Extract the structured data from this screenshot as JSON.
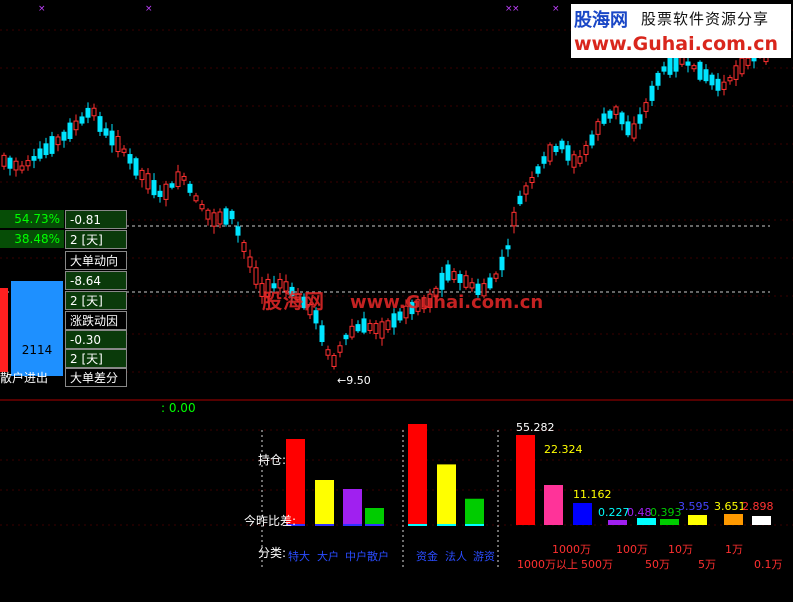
{
  "watermark": {
    "logo_cn": "股海网",
    "logo_tag": "股票软件资源分享",
    "logo_url": "www.Guhai.com.cn",
    "mid_cn": "股海网",
    "mid_url": "www.Guhai.com.cn"
  },
  "price_chart": {
    "low_marker": "←9.50",
    "low_price": 9.5,
    "price_range": [
      9.2,
      12.7
    ]
  },
  "side_panel": {
    "pct1": "54.73%",
    "pct2": "38.48%",
    "rows": [
      {
        "value": "-0.81",
        "days": "2 [天]",
        "label": "大单动向"
      },
      {
        "value": "-8.64",
        "days": "2 [天]",
        "label": "涨跌动因"
      },
      {
        "value": "-0.30",
        "days": "2 [天]",
        "label": "大单差分"
      }
    ],
    "box_value": "2114",
    "bottom_label": "散户进出",
    "colors": {
      "green": "#00ff00",
      "blue": "#1e90ff",
      "red": "#ff2020"
    }
  },
  "indicator": {
    "zero_label": ": 0.00",
    "label_hold": "持仓:",
    "label_diff": "今昨比差:",
    "label_class": "分类:"
  },
  "chart_data": {
    "type": "bar",
    "groups": [
      {
        "categories": [
          "特大",
          "大户",
          "中户",
          "散户"
        ],
        "values": [
          0.86,
          0.45,
          0.36,
          0.17
        ],
        "colors": [
          "#ff0000",
          "#ffff00",
          "#a020f0",
          "#00cc00"
        ]
      },
      {
        "categories": [
          "资金",
          "法人",
          "游资"
        ],
        "values": [
          1.0,
          0.6,
          0.26
        ],
        "colors": [
          "#ff0000",
          "#ffff00",
          "#00cc00"
        ]
      },
      {
        "categories": [
          "1000万以上",
          "500万",
          "1000万",
          "100万",
          "50万",
          "10万",
          "5万",
          "1万",
          "0.1万"
        ],
        "values": [
          55.282,
          22.324,
          11.162,
          0.227,
          0.48,
          0.393,
          3.595,
          3.651,
          2.898
        ],
        "value_labels": [
          "55.282",
          "22.324",
          "11.162",
          "0.227",
          "0.48",
          "0.393",
          "3.595",
          "3.651",
          "2.898"
        ],
        "colors": [
          "#ff0000",
          "#ff3399",
          "#0000ff",
          "#a020f0",
          "#00ffff",
          "#00cc00",
          "#ffff00",
          "#ff9900",
          "#ffffff"
        ],
        "label_colors": [
          "#ffffff",
          "#ffff00",
          "#ffff00",
          "#00ffff",
          "#a020f0",
          "#00cc00",
          "#4444ff",
          "#ffff00",
          "#ff3333"
        ]
      }
    ],
    "class_labels_row1": [
      "1000万",
      "100万",
      "10万",
      "1万"
    ],
    "class_labels_row2": [
      "1000万以上",
      "500万",
      "50万",
      "5万",
      "0.1万"
    ],
    "xlabel": "",
    "ylabel": ""
  }
}
